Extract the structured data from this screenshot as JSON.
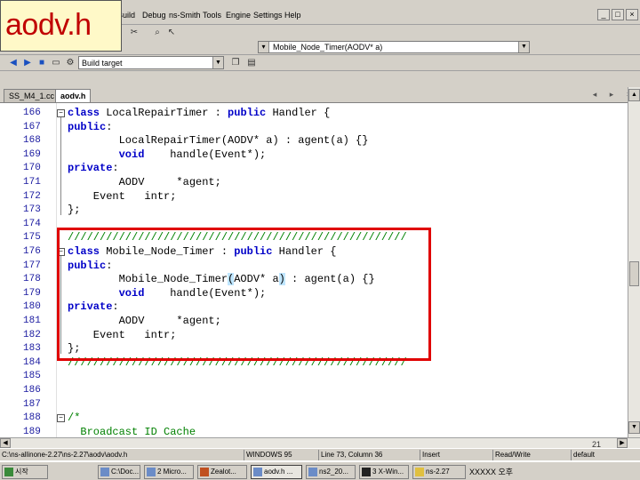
{
  "title_overlay": "aodv.h",
  "menu": {
    "items": [
      "Build",
      "Debug",
      "ns-Smith",
      "Tools",
      "Engine",
      "Settings",
      "Help"
    ]
  },
  "window_controls": [
    "_",
    "□",
    "×"
  ],
  "toolbar": {
    "function_combo_value": "Mobile_Node_Timer(AODV* a)",
    "build_combo_value": "Build target"
  },
  "tabs": [
    {
      "label": "SS_M4_1.cc",
      "active": false
    },
    {
      "label": "aodv.h",
      "active": true
    }
  ],
  "tab_controls": "◂ ▸ ×",
  "editor": {
    "lines": [
      {
        "num": "166",
        "fold": "−",
        "text": "class LocalRepairTimer : public Handler {"
      },
      {
        "num": "167",
        "fold": "",
        "text": "public:"
      },
      {
        "num": "168",
        "fold": "",
        "text": "        LocalRepairTimer(AODV* a) : agent(a) {}"
      },
      {
        "num": "169",
        "fold": "",
        "text": "        void    handle(Event*);"
      },
      {
        "num": "170",
        "fold": "",
        "text": "private:"
      },
      {
        "num": "171",
        "fold": "",
        "text": "        AODV     *agent;"
      },
      {
        "num": "172",
        "fold": "",
        "text": "    Event   intr;"
      },
      {
        "num": "173",
        "fold": "",
        "text": "};"
      },
      {
        "num": "174",
        "fold": "",
        "text": ""
      },
      {
        "num": "175",
        "fold": "",
        "text": "/////////////////////////////////////////////////////"
      },
      {
        "num": "176",
        "fold": "−",
        "text": "class Mobile_Node_Timer : public Handler {"
      },
      {
        "num": "177",
        "fold": "",
        "text": "public:"
      },
      {
        "num": "178",
        "fold": "",
        "text": "        Mobile_Node_Timer(AODV* a) : agent(a) {}"
      },
      {
        "num": "179",
        "fold": "",
        "text": "        void    handle(Event*);"
      },
      {
        "num": "180",
        "fold": "",
        "text": "private:"
      },
      {
        "num": "181",
        "fold": "",
        "text": "        AODV     *agent;"
      },
      {
        "num": "182",
        "fold": "",
        "text": "    Event   intr;"
      },
      {
        "num": "183",
        "fold": "",
        "text": "};"
      },
      {
        "num": "184",
        "fold": "",
        "text": "/////////////////////////////////////////////////////"
      },
      {
        "num": "185",
        "fold": "",
        "text": ""
      },
      {
        "num": "186",
        "fold": "",
        "text": ""
      },
      {
        "num": "187",
        "fold": "",
        "text": ""
      },
      {
        "num": "188",
        "fold": "−",
        "text": "/*"
      },
      {
        "num": "189",
        "fold": "",
        "text": "  Broadcast ID Cache"
      }
    ]
  },
  "slide_number": "21",
  "statusbar": {
    "path": "C:\\ns-allinone-2.27\\ns-2.27\\aodv\\aodv.h",
    "platform": "WINDOWS 95",
    "position": "Line 73, Column 36",
    "mode1": "Insert",
    "mode2": "Read/Write",
    "mode3": "default"
  },
  "taskbar": {
    "tasks": [
      {
        "label": "시작"
      },
      {
        "label": "C:\\Doc..."
      },
      {
        "label": "2 Micro..."
      },
      {
        "label": "Zealot..."
      },
      {
        "label": "aodv.h ...",
        "active": true
      },
      {
        "label": "ns2_20..."
      },
      {
        "label": "3 X-Win..."
      },
      {
        "label": "ns-2.27"
      }
    ],
    "tray": "XXXXX 오후"
  }
}
